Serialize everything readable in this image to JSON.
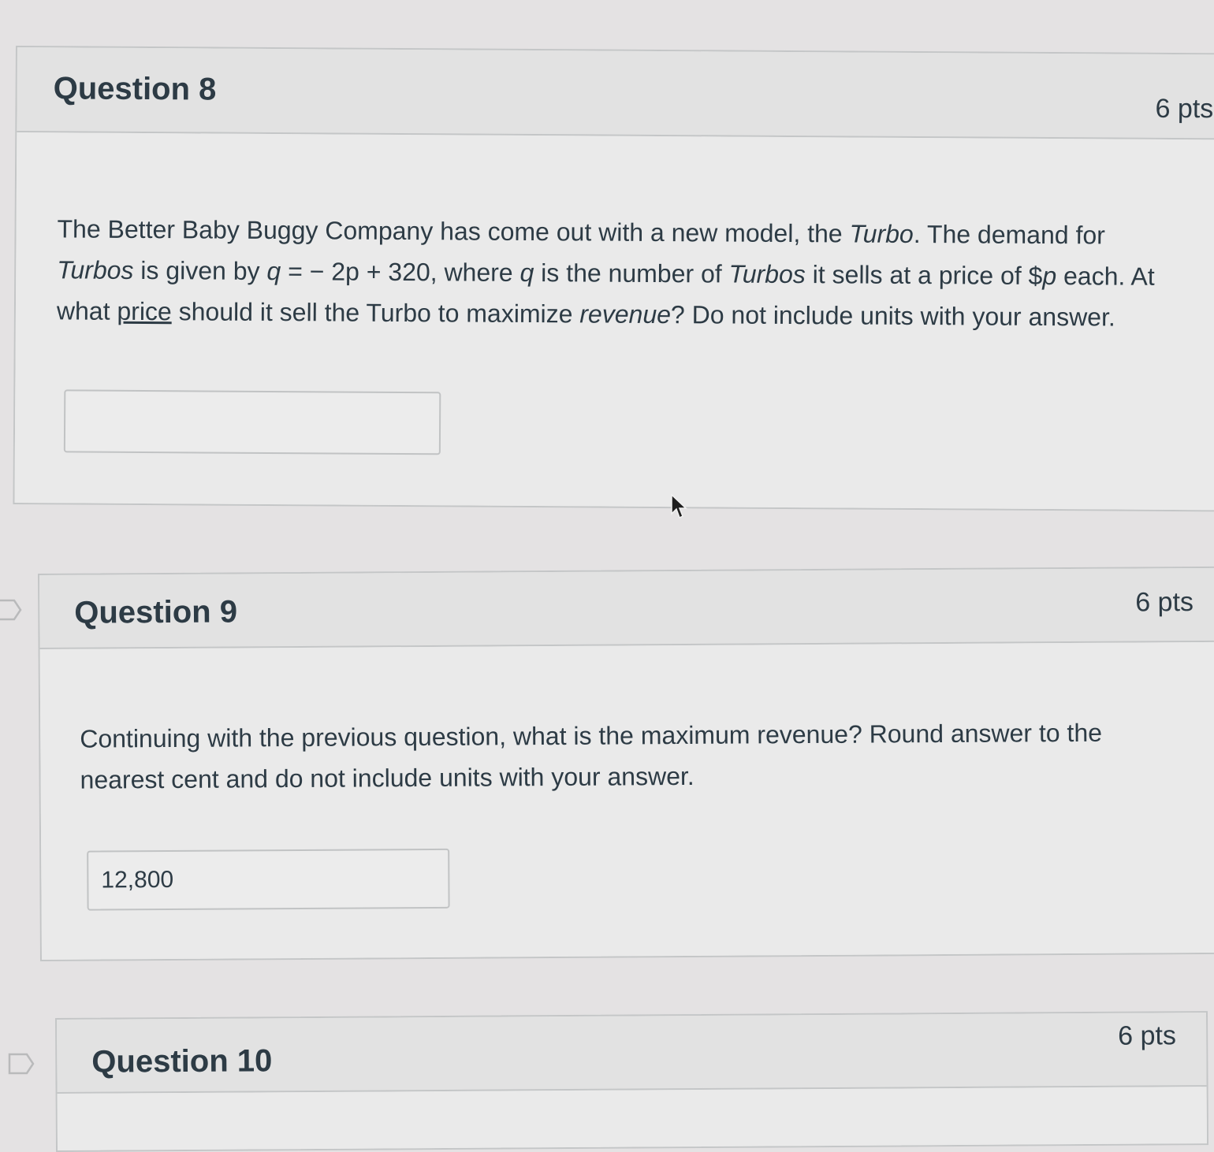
{
  "questions": [
    {
      "title": "Question 8",
      "points": "6 pts",
      "text_parts": {
        "p1": "The Better Baby Buggy Company has come out with a new model, the ",
        "turbo1": "Turbo",
        "p2": ". The demand for",
        "turbos1": "Turbos",
        "p3": " is given by ",
        "q1": "q",
        "eq": " = − 2p + 320",
        "p4": ", where ",
        "q2": "q",
        "p5": " is the number of ",
        "turbos2": "Turbos",
        "p6": " it sells at a price of $",
        "p_var": "p",
        "p7": " each. At",
        "p8": "what ",
        "price": "price",
        "p9": " should it sell the Turbo to maximize ",
        "revenue": "revenue",
        "p10": "? Do not include units with your answer."
      },
      "answer_value": ""
    },
    {
      "title": "Question 9",
      "points": "6 pts",
      "text_line1": "Continuing with the previous question, what is the maximum revenue? Round answer to the",
      "text_line2": "nearest cent and do not include units with your answer.",
      "answer_value": "12,800"
    },
    {
      "title": "Question 10",
      "points": "6 pts"
    }
  ],
  "icons": {
    "flag": "flag-outline-icon",
    "cursor": "mouse-pointer-icon"
  }
}
